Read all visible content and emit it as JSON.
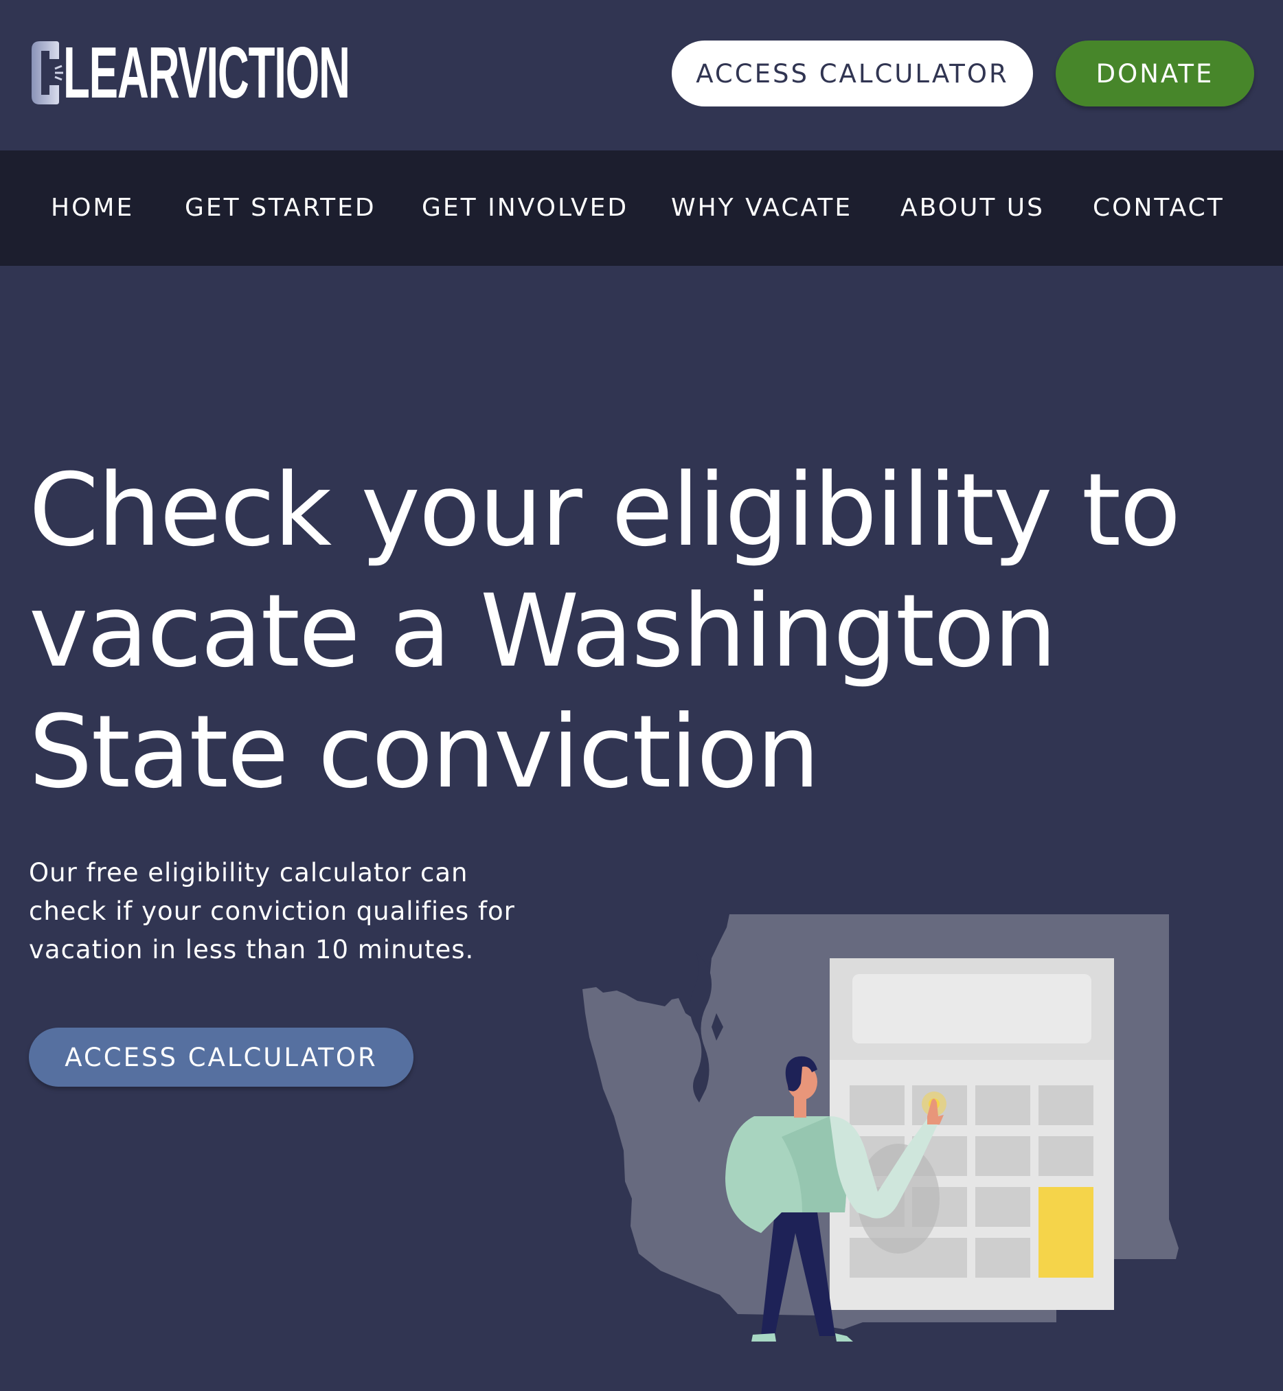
{
  "header": {
    "logo_text": "CLEARVICTION",
    "access_calculator_label": "ACCESS CALCULATOR",
    "donate_label": "DONATE"
  },
  "nav": {
    "items": [
      {
        "label": "HOME"
      },
      {
        "label": "GET STARTED"
      },
      {
        "label": "GET INVOLVED"
      },
      {
        "label": "WHY VACATE"
      },
      {
        "label": "ABOUT US"
      },
      {
        "label": "CONTACT"
      }
    ]
  },
  "hero": {
    "title": "Check your eligibility to vacate a Washington State conviction",
    "subtitle": "Our free eligibility calculator can check if your conviction qualifies for vacation in less than 10 minutes.",
    "cta_label": "ACCESS CALCULATOR"
  },
  "colors": {
    "background": "#313552",
    "nav_background": "#1c1e2e",
    "donate_green": "#47862a",
    "hero_button": "#5670a0",
    "calculator_yellow": "#f5d44a",
    "state_map": "#676a7f"
  },
  "illustration": {
    "icon": "washington-state-calculator-illustration"
  }
}
